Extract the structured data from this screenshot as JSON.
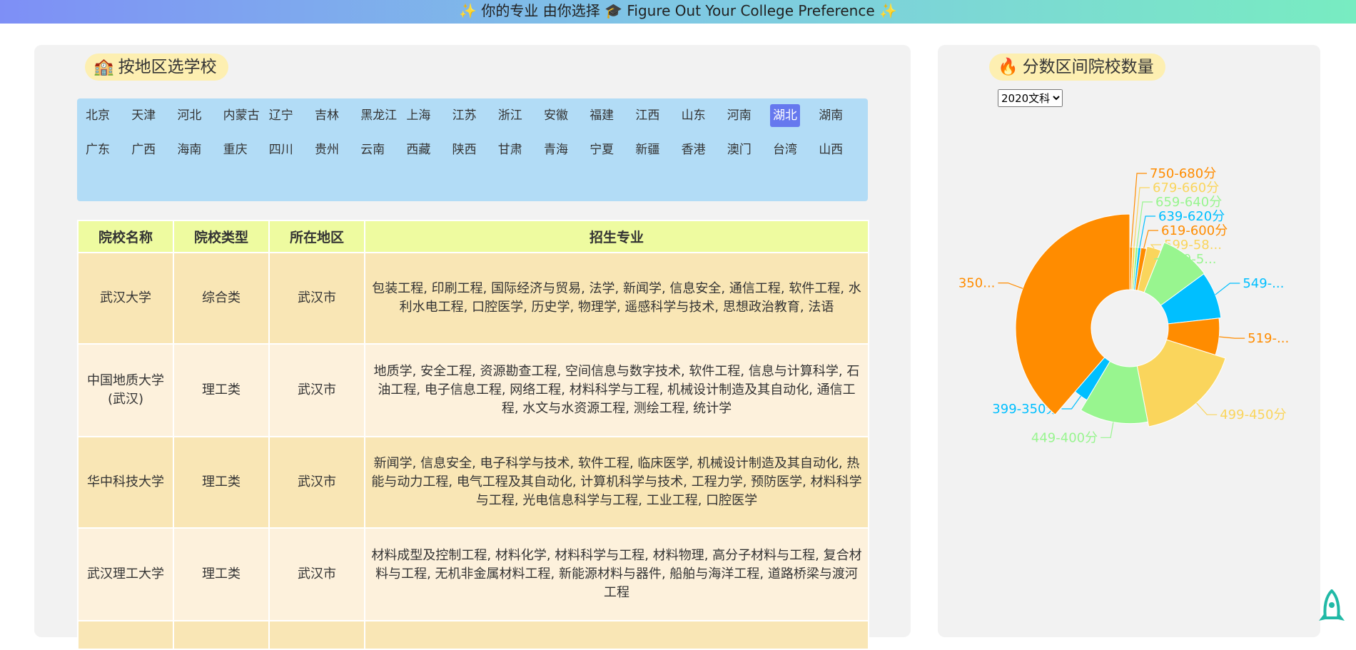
{
  "banner": {
    "text": "你的专业 由你选择 🎓 Figure Out Your College Preference"
  },
  "left_panel": {
    "title": "按地区选学校",
    "regions": [
      "北京",
      "天津",
      "河北",
      "内蒙古",
      "辽宁",
      "吉林",
      "黑龙江",
      "上海",
      "江苏",
      "浙江",
      "安徽",
      "福建",
      "江西",
      "山东",
      "河南",
      "湖北",
      "湖南",
      "广东",
      "广西",
      "海南",
      "重庆",
      "四川",
      "贵州",
      "云南",
      "西藏",
      "陕西",
      "甘肃",
      "青海",
      "宁夏",
      "新疆",
      "香港",
      "澳门",
      "台湾",
      "山西"
    ],
    "active_region": "湖北",
    "table": {
      "headers": [
        "院校名称",
        "院校类型",
        "所在地区",
        "招生专业"
      ],
      "rows": [
        {
          "name": "武汉大学",
          "type": "综合类",
          "city": "武汉市",
          "majors": "包装工程, 印刷工程, 国际经济与贸易, 法学, 新闻学, 信息安全, 通信工程, 软件工程, 水利水电工程, 口腔医学, 历史学, 物理学, 遥感科学与技术, 思想政治教育, 法语"
        },
        {
          "name": "中国地质大学(武汉)",
          "type": "理工类",
          "city": "武汉市",
          "majors": "地质学, 安全工程, 资源勘查工程, 空间信息与数字技术, 软件工程, 信息与计算科学, 石油工程, 电子信息工程, 网络工程, 材料科学与工程, 机械设计制造及其自动化, 通信工程, 水文与水资源工程, 测绘工程, 统计学"
        },
        {
          "name": "华中科技大学",
          "type": "理工类",
          "city": "武汉市",
          "majors": "新闻学, 信息安全, 电子科学与技术, 软件工程, 临床医学, 机械设计制造及其自动化, 热能与动力工程, 电气工程及其自动化, 计算机科学与技术, 工程力学, 预防医学, 材料科学与工程, 光电信息科学与工程, 工业工程, 口腔医学"
        },
        {
          "name": "武汉理工大学",
          "type": "理工类",
          "city": "武汉市",
          "majors": "材料成型及控制工程, 材料化学, 材料科学与工程, 材料物理, 高分子材料与工程, 复合材料与工程, 无机非金属材料工程, 新能源材料与器件, 船舶与海洋工程, 道路桥梁与渡河工程"
        }
      ]
    }
  },
  "right_panel": {
    "title": "分数区间院校数量",
    "select": {
      "value": "2020文科",
      "options": [
        "2020文科"
      ]
    }
  },
  "chart_data": {
    "type": "pie",
    "donut": true,
    "title": "",
    "slices": [
      {
        "label": "750-680分",
        "value": 1,
        "color": "#ff8c00"
      },
      {
        "label": "679-660分",
        "value": 1,
        "color": "#fad55c"
      },
      {
        "label": "659-640分",
        "value": 1,
        "color": "#98f58f"
      },
      {
        "label": "639-620分",
        "value": 1,
        "color": "#00bfff"
      },
      {
        "label": "619-600分",
        "value": 2,
        "color": "#ff8c00"
      },
      {
        "label": "599-58...",
        "value": 5,
        "color": "#fad55c"
      },
      {
        "label": "579-5...",
        "value": 16,
        "color": "#98f58f"
      },
      {
        "label": "549-...",
        "value": 15,
        "color": "#00bfff"
      },
      {
        "label": "519-...",
        "value": 12,
        "color": "#ff8c00"
      },
      {
        "label": "499-450分",
        "value": 31,
        "color": "#fad55c"
      },
      {
        "label": "449-400分",
        "value": 21,
        "color": "#98f58f"
      },
      {
        "label": "399-350分",
        "value": 5,
        "color": "#00bfff"
      },
      {
        "label": "350...",
        "value": 70,
        "color": "#ff8c00"
      }
    ]
  }
}
